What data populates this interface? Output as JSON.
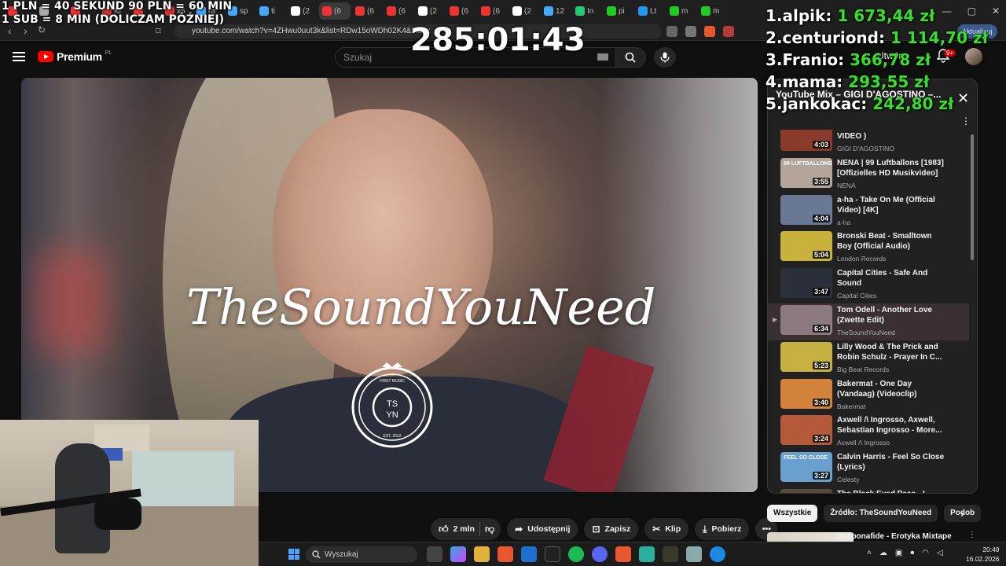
{
  "browser": {
    "url": "youtube.com/watch?v=4ZHwu0uut3k&list=RDw15oWDh02K4&index",
    "update_label": "Aktualizuj",
    "tab_labels": [
      "",
      "",
      "",
      "Ki",
      "",
      "x5",
      "ra",
      "sp",
      "ti",
      "(2",
      "(6",
      "(6",
      "(6",
      "(2",
      "(6",
      "(6",
      "(2",
      "12",
      "In",
      "pi",
      "Lt",
      "m",
      "m"
    ]
  },
  "overlay": {
    "rules_line1": "1 PLN = 40 SEKUND 90 PLN = 60 MIN",
    "rules_line2": "1 SUB = 8 MIN (DOLICZAM PÓŹNIEJ)",
    "timer": "285:01:43",
    "leaderboard": [
      {
        "rank": "1.",
        "name": "alpik:",
        "amount": "1 673,44 zł"
      },
      {
        "rank": "2.",
        "name": "centuriond:",
        "amount": "1 114,70 zł"
      },
      {
        "rank": "3.",
        "name": "Franio:",
        "amount": "366,78 zł"
      },
      {
        "rank": "4.",
        "name": "mama:",
        "amount": "293,55 zł"
      },
      {
        "rank": "5.",
        "name": "jankokac:",
        "amount": "242,80 zł"
      }
    ]
  },
  "header": {
    "logo_text": "Premium",
    "logo_region": "PL",
    "search_placeholder": "Szukaj",
    "create_label": "Utwórz",
    "notifications_count": "9+"
  },
  "video": {
    "brand_text": "TheSoundYouNeed",
    "badge_line1": "TS",
    "badge_line2": "YN",
    "badge_top": "FIRST MUSIC",
    "badge_bottom": "EST. 2012"
  },
  "actions": {
    "like_count": "2 mln",
    "share": "Udostępnij",
    "save": "Zapisz",
    "clip": "Klip",
    "download": "Pobierz"
  },
  "playlist": {
    "title": "YouTube Mix – GIGI D'AGOSTINO –...",
    "items": [
      {
        "title": "TOUJOURS ( OFFICIAL VIDEO )",
        "channel": "GIGI D'AGOSTINO",
        "duration": "4:03",
        "current": false
      },
      {
        "title": "NENA | 99 Luftballons [1983] [Offizielles HD Musikvideo]",
        "channel": "NENA",
        "duration": "3:55",
        "current": false
      },
      {
        "title": "a-ha - Take On Me (Official Video) [4K]",
        "channel": "a-ha",
        "duration": "4:04",
        "current": false
      },
      {
        "title": "Bronski Beat - Smalltown Boy (Official Audio)",
        "channel": "London Records",
        "duration": "5:04",
        "current": false
      },
      {
        "title": "Capital Cities - Safe And Sound",
        "channel": "Capital Cities",
        "duration": "3:47",
        "current": false
      },
      {
        "title": "Tom Odell - Another Love (Zwette Edit)",
        "channel": "TheSoundYouNeed",
        "duration": "6:34",
        "current": true
      },
      {
        "title": "Lilly Wood & The Prick and Robin Schulz - Prayer In C...",
        "channel": "Big Beat Records",
        "duration": "5:23",
        "current": false
      },
      {
        "title": "Bakermat - One Day (Vandaag) (Videoclip)",
        "channel": "Bakermat",
        "duration": "3:40",
        "current": false
      },
      {
        "title": "Axwell /\\ Ingrosso, Axwell, Sebastian Ingrosso - More...",
        "channel": "Axwell Λ Ingrosso",
        "duration": "3:24",
        "current": false
      },
      {
        "title": "Calvin Harris - Feel So Close (Lyrics)",
        "channel": "Celesty",
        "duration": "3:27",
        "current": false
      },
      {
        "title": "The Black Eyed Peas - I Gotta Feeling (Official Music Video)",
        "channel": "",
        "duration": "",
        "current": false
      }
    ],
    "thumb_colors": [
      "#8a3a2a",
      "#b3a59a",
      "#6b7894",
      "#c9b23c",
      "#2a2f3a",
      "#8c7a80",
      "#c6b041",
      "#d2823a",
      "#b45a3a",
      "#6aa0d0",
      "#5a4a3a"
    ],
    "thumb_texts": [
      "",
      "99 LUFTBALLONS",
      "",
      "",
      "",
      "",
      "",
      "",
      "",
      "FEEL SO CLOSE",
      ""
    ]
  },
  "chips": [
    "Wszystkie",
    "Źródło: TheSoundYouNeed",
    "Podob"
  ],
  "recommendation": {
    "title": "Quebonafide - Erotyka Mixtape"
  },
  "taskbar": {
    "search_placeholder": "Wyszukaj",
    "time": "20:49",
    "date": "16.02.2026"
  }
}
